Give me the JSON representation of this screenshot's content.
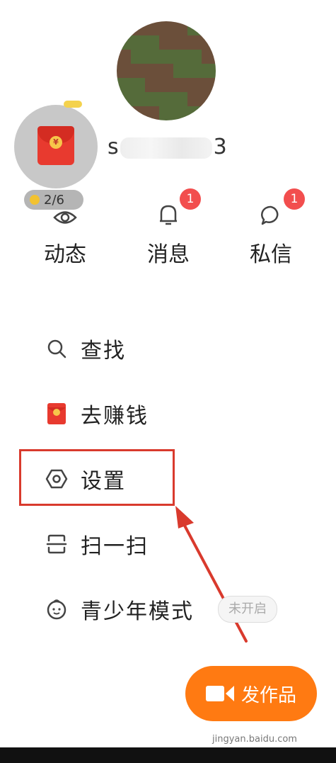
{
  "profile": {
    "username_prefix": "s",
    "username_suffix": "3",
    "packet_progress": "2/6"
  },
  "nav": [
    {
      "label": "动态",
      "badge": null
    },
    {
      "label": "消息",
      "badge": "1"
    },
    {
      "label": "私信",
      "badge": "1"
    }
  ],
  "menu": {
    "search": "查找",
    "earn": "去赚钱",
    "settings": "设置",
    "scan": "扫一扫",
    "teen_mode": "青少年模式",
    "teen_mode_status": "未开启"
  },
  "publish_label": "发作品",
  "watermark": "jingyan.baidu.com",
  "colors": {
    "accent_orange": "#ff7a12",
    "badge_red": "#f24e4e",
    "highlight_red": "#d93a2d"
  }
}
